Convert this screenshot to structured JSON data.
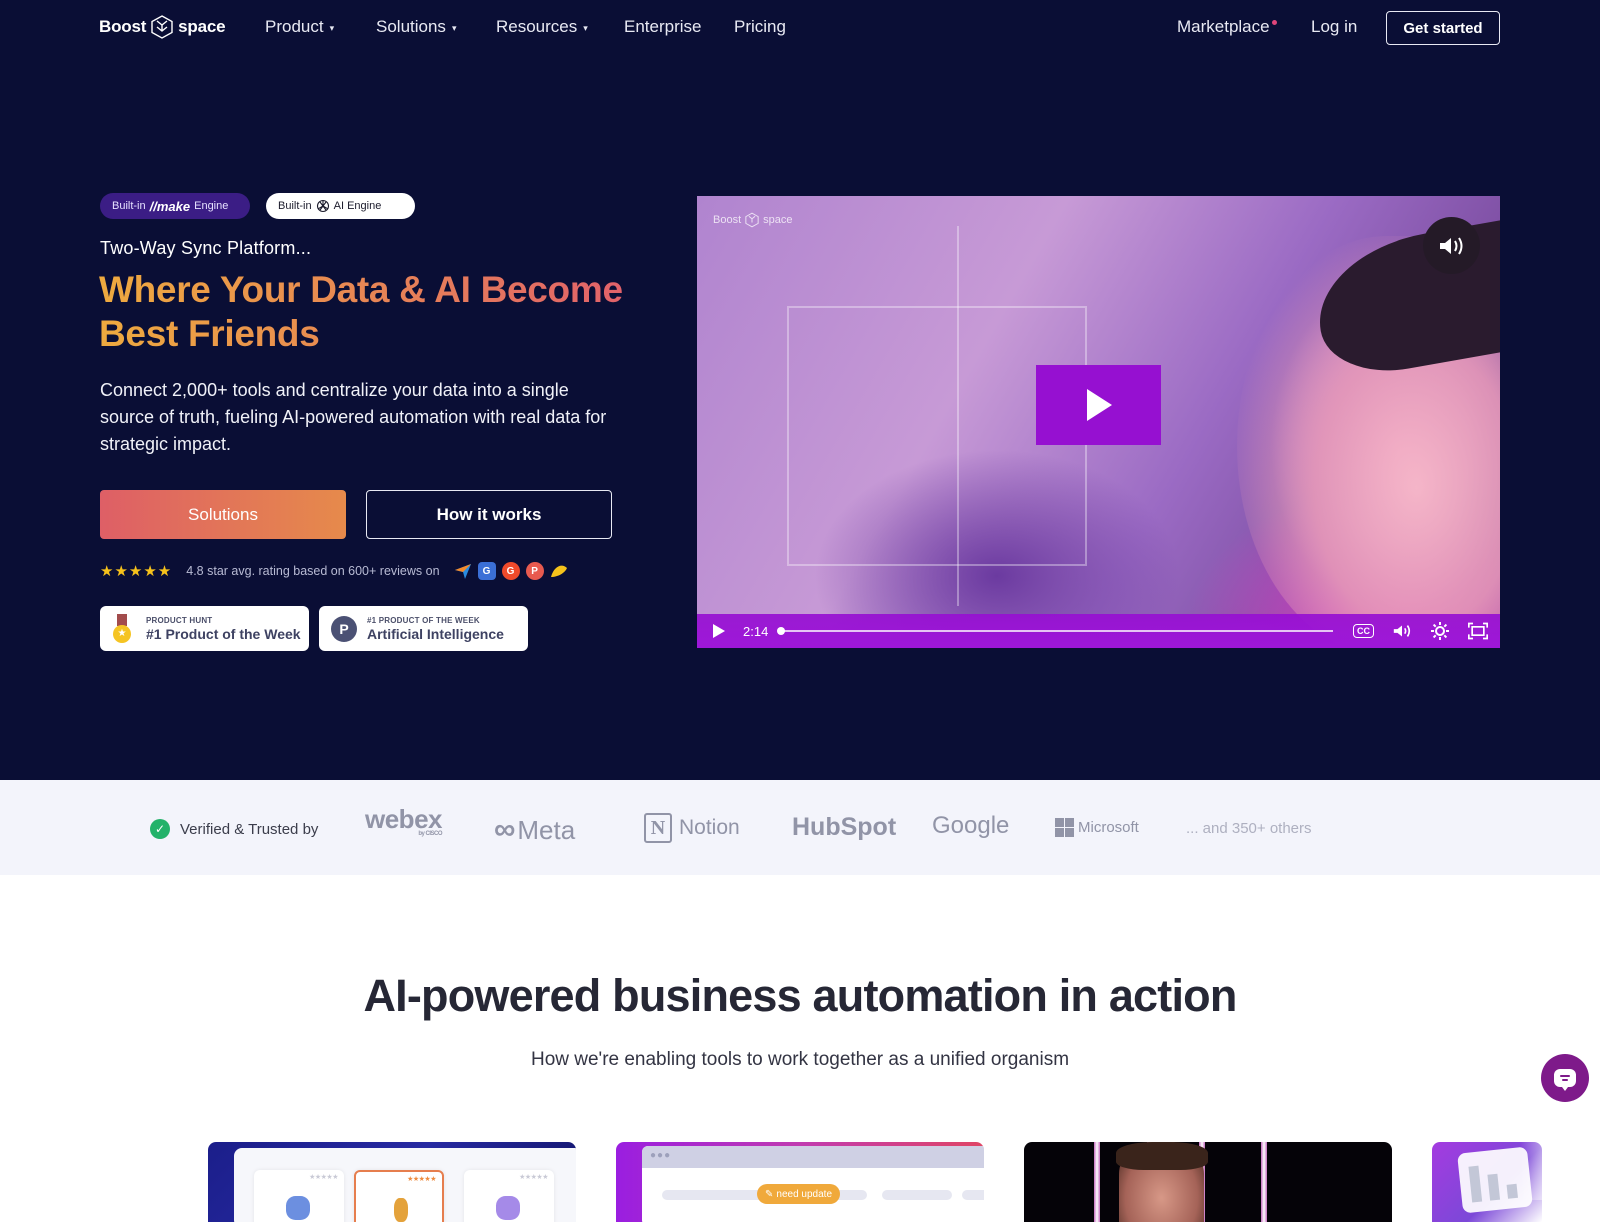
{
  "nav": {
    "logo_left": "Boost",
    "logo_right": "space",
    "items": [
      {
        "label": "Product",
        "has_dropdown": true
      },
      {
        "label": "Solutions",
        "has_dropdown": true
      },
      {
        "label": "Resources",
        "has_dropdown": true
      },
      {
        "label": "Enterprise",
        "has_dropdown": false
      },
      {
        "label": "Pricing",
        "has_dropdown": false
      }
    ],
    "marketplace": "Marketplace",
    "login": "Log in",
    "cta": "Get started",
    "caret": "▾"
  },
  "hero": {
    "badges": {
      "make_prefix": "Built-in",
      "make_brand": "make",
      "make_suffix": "Engine",
      "ai_prefix": "Built-in",
      "ai_suffix": "AI Engine"
    },
    "tagline": "Two-Way Sync Platform...",
    "headline": "Where Your Data & AI Become Best Friends",
    "subtext": "Connect 2,000+ tools and centralize your data into a single source of truth, fueling AI-powered automation with real data for strategic impact.",
    "primary_button": "Solutions",
    "secondary_button": "How it works",
    "rating": {
      "stars": "★★★★★",
      "score": 4.8,
      "text": "4.8 star avg. rating based on 600+ reviews on",
      "review_sites": [
        "capterra-icon",
        "google-business-icon",
        "g2-icon",
        "product-hunt-icon",
        "getapp-icon"
      ]
    },
    "awards": [
      {
        "small": "PRODUCT HUNT",
        "big": "#1 Product of the Week"
      },
      {
        "small": "#1 PRODUCT OF THE WEEK",
        "big": "Artificial Intelligence"
      }
    ]
  },
  "video": {
    "watermark_left": "Boost",
    "watermark_right": "space",
    "time": "2:14",
    "progress": 0,
    "cc_label": "CC",
    "colors": {
      "accent": "#9610d1"
    }
  },
  "trusted": {
    "label": "Verified & Trusted by",
    "brands": {
      "webex": "webex",
      "webex_by": "by CISCO",
      "meta": "Meta",
      "notion": "Notion",
      "notion_n": "N",
      "hubspot": "HubSpot",
      "google": "Google",
      "microsoft": "Microsoft"
    },
    "others": "... and 350+ others"
  },
  "section": {
    "title": "AI-powered business automation in action",
    "subtitle": "How we're enabling tools to work together as a unified organism",
    "card2_badge": "need update",
    "mini_stars": "★★★★★"
  },
  "colors": {
    "hero_bg": "#0a0e35",
    "headline_gradient": [
      "#eeaa3f",
      "#e05d6d"
    ],
    "chat_button": "#7e1a8a",
    "verified_green": "#23b26a"
  }
}
